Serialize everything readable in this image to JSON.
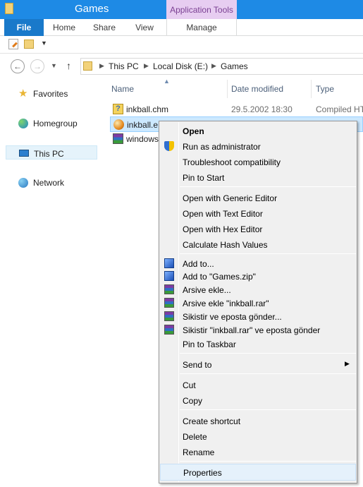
{
  "window": {
    "title": "Games"
  },
  "ribbon": {
    "contextual_group": "Application Tools",
    "tabs": {
      "file": "File",
      "home": "Home",
      "share": "Share",
      "view": "View",
      "manage": "Manage"
    }
  },
  "address": {
    "breadcrumbs": [
      "This PC",
      "Local Disk (E:)",
      "Games"
    ]
  },
  "nav_pane": {
    "items": [
      "Favorites",
      "Homegroup",
      "This PC",
      "Network"
    ],
    "selected": "This PC"
  },
  "file_list": {
    "columns": {
      "name": "Name",
      "date": "Date modified",
      "type": "Type"
    },
    "rows": [
      {
        "name": "inkball.chm",
        "date": "29.5.2002 18:30",
        "type": "Compiled HT",
        "icon": "help-file-icon"
      },
      {
        "name": "inkball.e",
        "date": "",
        "type": "",
        "icon": "application-icon",
        "selected": true
      },
      {
        "name": "windows",
        "date": "",
        "type": "",
        "icon": "winrar-archive-icon"
      }
    ]
  },
  "context_menu": {
    "open": "Open",
    "run_as_admin": "Run as administrator",
    "troubleshoot": "Troubleshoot compatibility",
    "pin_start": "Pin to Start",
    "open_generic": "Open with Generic Editor",
    "open_text": "Open with Text Editor",
    "open_hex": "Open with Hex Editor",
    "calc_hash": "Calculate Hash Values",
    "add_to": "Add to...",
    "add_to_zip": "Add to  \"Games.zip\"",
    "arsive_ekle": "Arsive ekle...",
    "arsive_ekle_rar": "Arsive ekle \"inkball.rar\"",
    "sikistir_eposta": "Sikistir ve eposta gönder...",
    "sikistir_rar_eposta": "Sikistir \"inkball.rar\" ve eposta gönder",
    "pin_taskbar": "Pin to Taskbar",
    "send_to": "Send to",
    "cut": "Cut",
    "copy": "Copy",
    "create_shortcut": "Create shortcut",
    "delete": "Delete",
    "rename": "Rename",
    "properties": "Properties",
    "highlighted": "Properties"
  },
  "colors": {
    "titlebar": "#1e8ae5",
    "file_tab": "#1979ca",
    "contextual_tab": "#e7cdf1",
    "selection": "#cce8ff"
  }
}
